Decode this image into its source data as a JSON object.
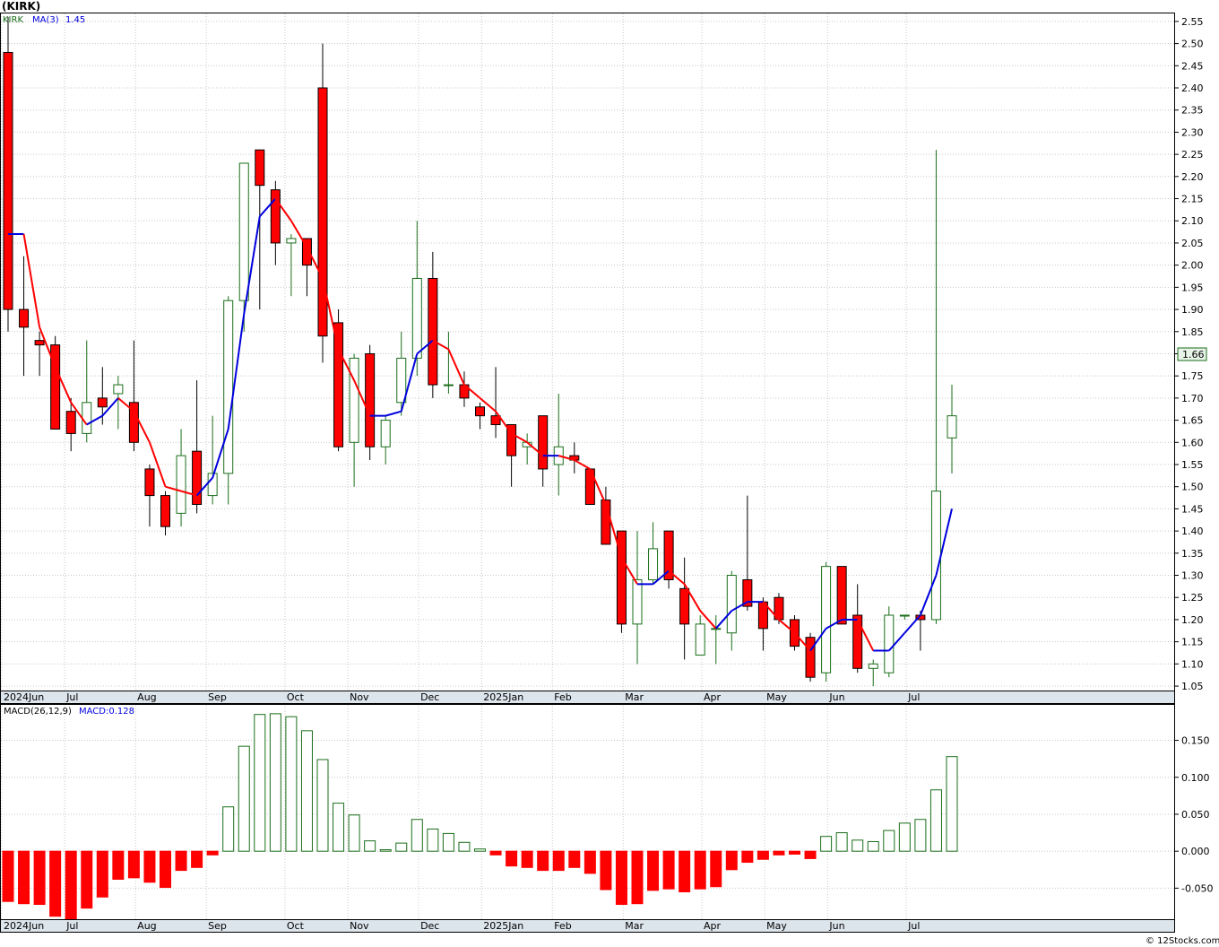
{
  "ticker_title": "(KIRK)",
  "price_legend": {
    "ticker": "KIRK",
    "ma_label": "MA(3)",
    "ma_value": "1.45"
  },
  "macd_legend": {
    "label": "MACD(26,12,9)",
    "value_label": "MACD:0.128"
  },
  "last_price_label": "1.66",
  "watermark": "© 12Stocks.com",
  "colors": {
    "up": "#1a6e1a",
    "down": "#ff0000",
    "ma_up": "#0000dd",
    "ma_down": "#ff0000",
    "x_strip": "#dce4ec"
  },
  "chart_data": [
    {
      "type": "candlestick",
      "series_name": "KIRK",
      "period": "weekly",
      "ylim": [
        1.04,
        2.57
      ],
      "y_ticks": [
        "1.05",
        "1.10",
        "1.15",
        "1.20",
        "1.25",
        "1.30",
        "1.35",
        "1.40",
        "1.45",
        "1.50",
        "1.55",
        "1.60",
        "1.65",
        "1.70",
        "1.75",
        "1.80",
        "1.85",
        "1.90",
        "1.95",
        "2.00",
        "2.05",
        "2.10",
        "2.15",
        "2.20",
        "2.25",
        "2.30",
        "2.35",
        "2.40",
        "2.45",
        "2.50",
        "2.55"
      ],
      "x_ticks": [
        "2024Jun",
        "Jul",
        "Aug",
        "Sep",
        "Oct",
        "Nov",
        "Dec",
        "2025Jan",
        "Feb",
        "Mar",
        "Apr",
        "May",
        "Jun",
        "Jul"
      ],
      "candles": [
        {
          "o": 2.48,
          "h": 2.56,
          "l": 1.85,
          "c": 1.9
        },
        {
          "o": 1.9,
          "h": 2.02,
          "l": 1.75,
          "c": 1.86
        },
        {
          "o": 1.83,
          "h": 1.85,
          "l": 1.75,
          "c": 1.82
        },
        {
          "o": 1.82,
          "h": 1.84,
          "l": 1.63,
          "c": 1.63
        },
        {
          "o": 1.67,
          "h": 1.7,
          "l": 1.58,
          "c": 1.62
        },
        {
          "o": 1.62,
          "h": 1.83,
          "l": 1.6,
          "c": 1.69
        },
        {
          "o": 1.7,
          "h": 1.77,
          "l": 1.64,
          "c": 1.68
        },
        {
          "o": 1.71,
          "h": 1.75,
          "l": 1.63,
          "c": 1.73
        },
        {
          "o": 1.69,
          "h": 1.83,
          "l": 1.58,
          "c": 1.6
        },
        {
          "o": 1.54,
          "h": 1.55,
          "l": 1.41,
          "c": 1.48
        },
        {
          "o": 1.48,
          "h": 1.49,
          "l": 1.39,
          "c": 1.41
        },
        {
          "o": 1.44,
          "h": 1.63,
          "l": 1.41,
          "c": 1.57
        },
        {
          "o": 1.58,
          "h": 1.74,
          "l": 1.44,
          "c": 1.46
        },
        {
          "o": 1.48,
          "h": 1.66,
          "l": 1.46,
          "c": 1.53
        },
        {
          "o": 1.53,
          "h": 1.93,
          "l": 1.46,
          "c": 1.92
        },
        {
          "o": 1.92,
          "h": 2.23,
          "l": 1.85,
          "c": 2.23
        },
        {
          "o": 2.26,
          "h": 2.26,
          "l": 1.9,
          "c": 2.18
        },
        {
          "o": 2.17,
          "h": 2.19,
          "l": 2.0,
          "c": 2.05
        },
        {
          "o": 2.05,
          "h": 2.07,
          "l": 1.93,
          "c": 2.06
        },
        {
          "o": 2.06,
          "h": 2.06,
          "l": 1.93,
          "c": 2.0
        },
        {
          "o": 2.4,
          "h": 2.5,
          "l": 1.78,
          "c": 1.84
        },
        {
          "o": 1.87,
          "h": 1.9,
          "l": 1.58,
          "c": 1.59
        },
        {
          "o": 1.6,
          "h": 1.8,
          "l": 1.5,
          "c": 1.79
        },
        {
          "o": 1.8,
          "h": 1.82,
          "l": 1.56,
          "c": 1.59
        },
        {
          "o": 1.59,
          "h": 1.66,
          "l": 1.55,
          "c": 1.65
        },
        {
          "o": 1.69,
          "h": 1.85,
          "l": 1.66,
          "c": 1.79
        },
        {
          "o": 1.79,
          "h": 2.1,
          "l": 1.75,
          "c": 1.97
        },
        {
          "o": 1.97,
          "h": 2.03,
          "l": 1.7,
          "c": 1.73
        },
        {
          "o": 1.73,
          "h": 1.85,
          "l": 1.71,
          "c": 1.73
        },
        {
          "o": 1.73,
          "h": 1.76,
          "l": 1.68,
          "c": 1.7
        },
        {
          "o": 1.68,
          "h": 1.69,
          "l": 1.63,
          "c": 1.66
        },
        {
          "o": 1.66,
          "h": 1.77,
          "l": 1.61,
          "c": 1.64
        },
        {
          "o": 1.64,
          "h": 1.64,
          "l": 1.5,
          "c": 1.57
        },
        {
          "o": 1.59,
          "h": 1.62,
          "l": 1.55,
          "c": 1.6
        },
        {
          "o": 1.66,
          "h": 1.66,
          "l": 1.5,
          "c": 1.54
        },
        {
          "o": 1.55,
          "h": 1.71,
          "l": 1.48,
          "c": 1.59
        },
        {
          "o": 1.57,
          "h": 1.6,
          "l": 1.53,
          "c": 1.56
        },
        {
          "o": 1.54,
          "h": 1.54,
          "l": 1.46,
          "c": 1.46
        },
        {
          "o": 1.47,
          "h": 1.5,
          "l": 1.37,
          "c": 1.37
        },
        {
          "o": 1.4,
          "h": 1.4,
          "l": 1.17,
          "c": 1.19
        },
        {
          "o": 1.19,
          "h": 1.4,
          "l": 1.1,
          "c": 1.29
        },
        {
          "o": 1.29,
          "h": 1.42,
          "l": 1.28,
          "c": 1.36
        },
        {
          "o": 1.4,
          "h": 1.4,
          "l": 1.27,
          "c": 1.29
        },
        {
          "o": 1.27,
          "h": 1.34,
          "l": 1.11,
          "c": 1.19
        },
        {
          "o": 1.12,
          "h": 1.21,
          "l": 1.12,
          "c": 1.19
        },
        {
          "o": 1.18,
          "h": 1.21,
          "l": 1.1,
          "c": 1.18
        },
        {
          "o": 1.17,
          "h": 1.31,
          "l": 1.13,
          "c": 1.3
        },
        {
          "o": 1.29,
          "h": 1.48,
          "l": 1.22,
          "c": 1.23
        },
        {
          "o": 1.24,
          "h": 1.25,
          "l": 1.13,
          "c": 1.18
        },
        {
          "o": 1.25,
          "h": 1.26,
          "l": 1.19,
          "c": 1.2
        },
        {
          "o": 1.2,
          "h": 1.21,
          "l": 1.13,
          "c": 1.14
        },
        {
          "o": 1.16,
          "h": 1.17,
          "l": 1.06,
          "c": 1.07
        },
        {
          "o": 1.08,
          "h": 1.33,
          "l": 1.06,
          "c": 1.32
        },
        {
          "o": 1.32,
          "h": 1.32,
          "l": 1.19,
          "c": 1.19
        },
        {
          "o": 1.21,
          "h": 1.28,
          "l": 1.08,
          "c": 1.09
        },
        {
          "o": 1.09,
          "h": 1.11,
          "l": 1.05,
          "c": 1.1
        },
        {
          "o": 1.08,
          "h": 1.23,
          "l": 1.07,
          "c": 1.21
        },
        {
          "o": 1.21,
          "h": 1.21,
          "l": 1.2,
          "c": 1.21
        },
        {
          "o": 1.21,
          "h": 1.22,
          "l": 1.13,
          "c": 1.2
        },
        {
          "o": 1.2,
          "h": 2.26,
          "l": 1.19,
          "c": 1.49
        },
        {
          "o": 1.61,
          "h": 1.73,
          "l": 1.53,
          "c": 1.66
        }
      ],
      "ma3": [
        2.07,
        2.07,
        1.86,
        1.77,
        1.69,
        1.64,
        1.66,
        1.7,
        1.67,
        1.6,
        1.5,
        1.49,
        1.48,
        1.52,
        1.63,
        1.89,
        2.11,
        2.15,
        2.1,
        2.04,
        1.97,
        1.81,
        1.74,
        1.66,
        1.66,
        1.67,
        1.8,
        1.83,
        1.81,
        1.73,
        1.7,
        1.67,
        1.62,
        1.6,
        1.57,
        1.57,
        1.56,
        1.54,
        1.46,
        1.34,
        1.28,
        1.28,
        1.31,
        1.28,
        1.22,
        1.18,
        1.22,
        1.24,
        1.24,
        1.2,
        1.17,
        1.13,
        1.18,
        1.2,
        1.2,
        1.13,
        1.13,
        1.17,
        1.21,
        1.3,
        1.45
      ]
    },
    {
      "type": "bar",
      "series_name": "MACD(26,12,9)",
      "ylim": [
        -0.092,
        0.198
      ],
      "y_ticks": [
        "-0.050",
        "0.000",
        "0.050",
        "0.100",
        "0.150"
      ],
      "x_ticks": [
        "2024Jun",
        "Jul",
        "Aug",
        "Sep",
        "Oct",
        "Nov",
        "Dec",
        "2025Jan",
        "Feb",
        "Mar",
        "Apr",
        "May",
        "Jun",
        "Jul"
      ],
      "values": [
        -0.068,
        -0.071,
        -0.072,
        -0.088,
        -0.095,
        -0.077,
        -0.062,
        -0.038,
        -0.036,
        -0.042,
        -0.049,
        -0.026,
        -0.022,
        -0.005,
        0.06,
        0.142,
        0.185,
        0.186,
        0.182,
        0.163,
        0.124,
        0.065,
        0.049,
        0.014,
        0.002,
        0.011,
        0.043,
        0.03,
        0.024,
        0.012,
        0.003,
        -0.005,
        -0.02,
        -0.022,
        -0.026,
        -0.026,
        -0.022,
        -0.03,
        -0.052,
        -0.072,
        -0.071,
        -0.053,
        -0.051,
        -0.055,
        -0.051,
        -0.048,
        -0.025,
        -0.015,
        -0.011,
        -0.005,
        -0.004,
        -0.01,
        0.02,
        0.025,
        0.015,
        0.013,
        0.028,
        0.038,
        0.043,
        0.083,
        0.128
      ]
    }
  ]
}
